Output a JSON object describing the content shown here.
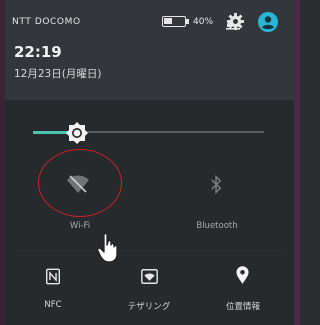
{
  "status_bar": {
    "carrier": "NTT DOCOMO",
    "battery_text": "40%",
    "battery_level": 0.4
  },
  "header": {
    "time": "22:19",
    "date": "12月23日(月曜日)"
  },
  "brightness": {
    "level": 0.2
  },
  "tiles": [
    {
      "label": "Wi-Fi",
      "icon": "wifi-off-icon",
      "state": "off"
    },
    {
      "label": "Bluetooth",
      "icon": "bluetooth-icon",
      "state": "off"
    },
    {
      "label": "NFC",
      "icon": "nfc-icon",
      "state": "on"
    },
    {
      "label": "テザリング",
      "icon": "tethering-icon",
      "state": "on"
    },
    {
      "label": "位置情報",
      "icon": "location-icon",
      "state": "on"
    }
  ],
  "annotation": {
    "highlight": "red-circle",
    "cursor": "hand-pointer-icon"
  },
  "colors": {
    "accent": "#4fc3b0",
    "avatar": "#29b6d6",
    "annotation": "#d02020"
  }
}
